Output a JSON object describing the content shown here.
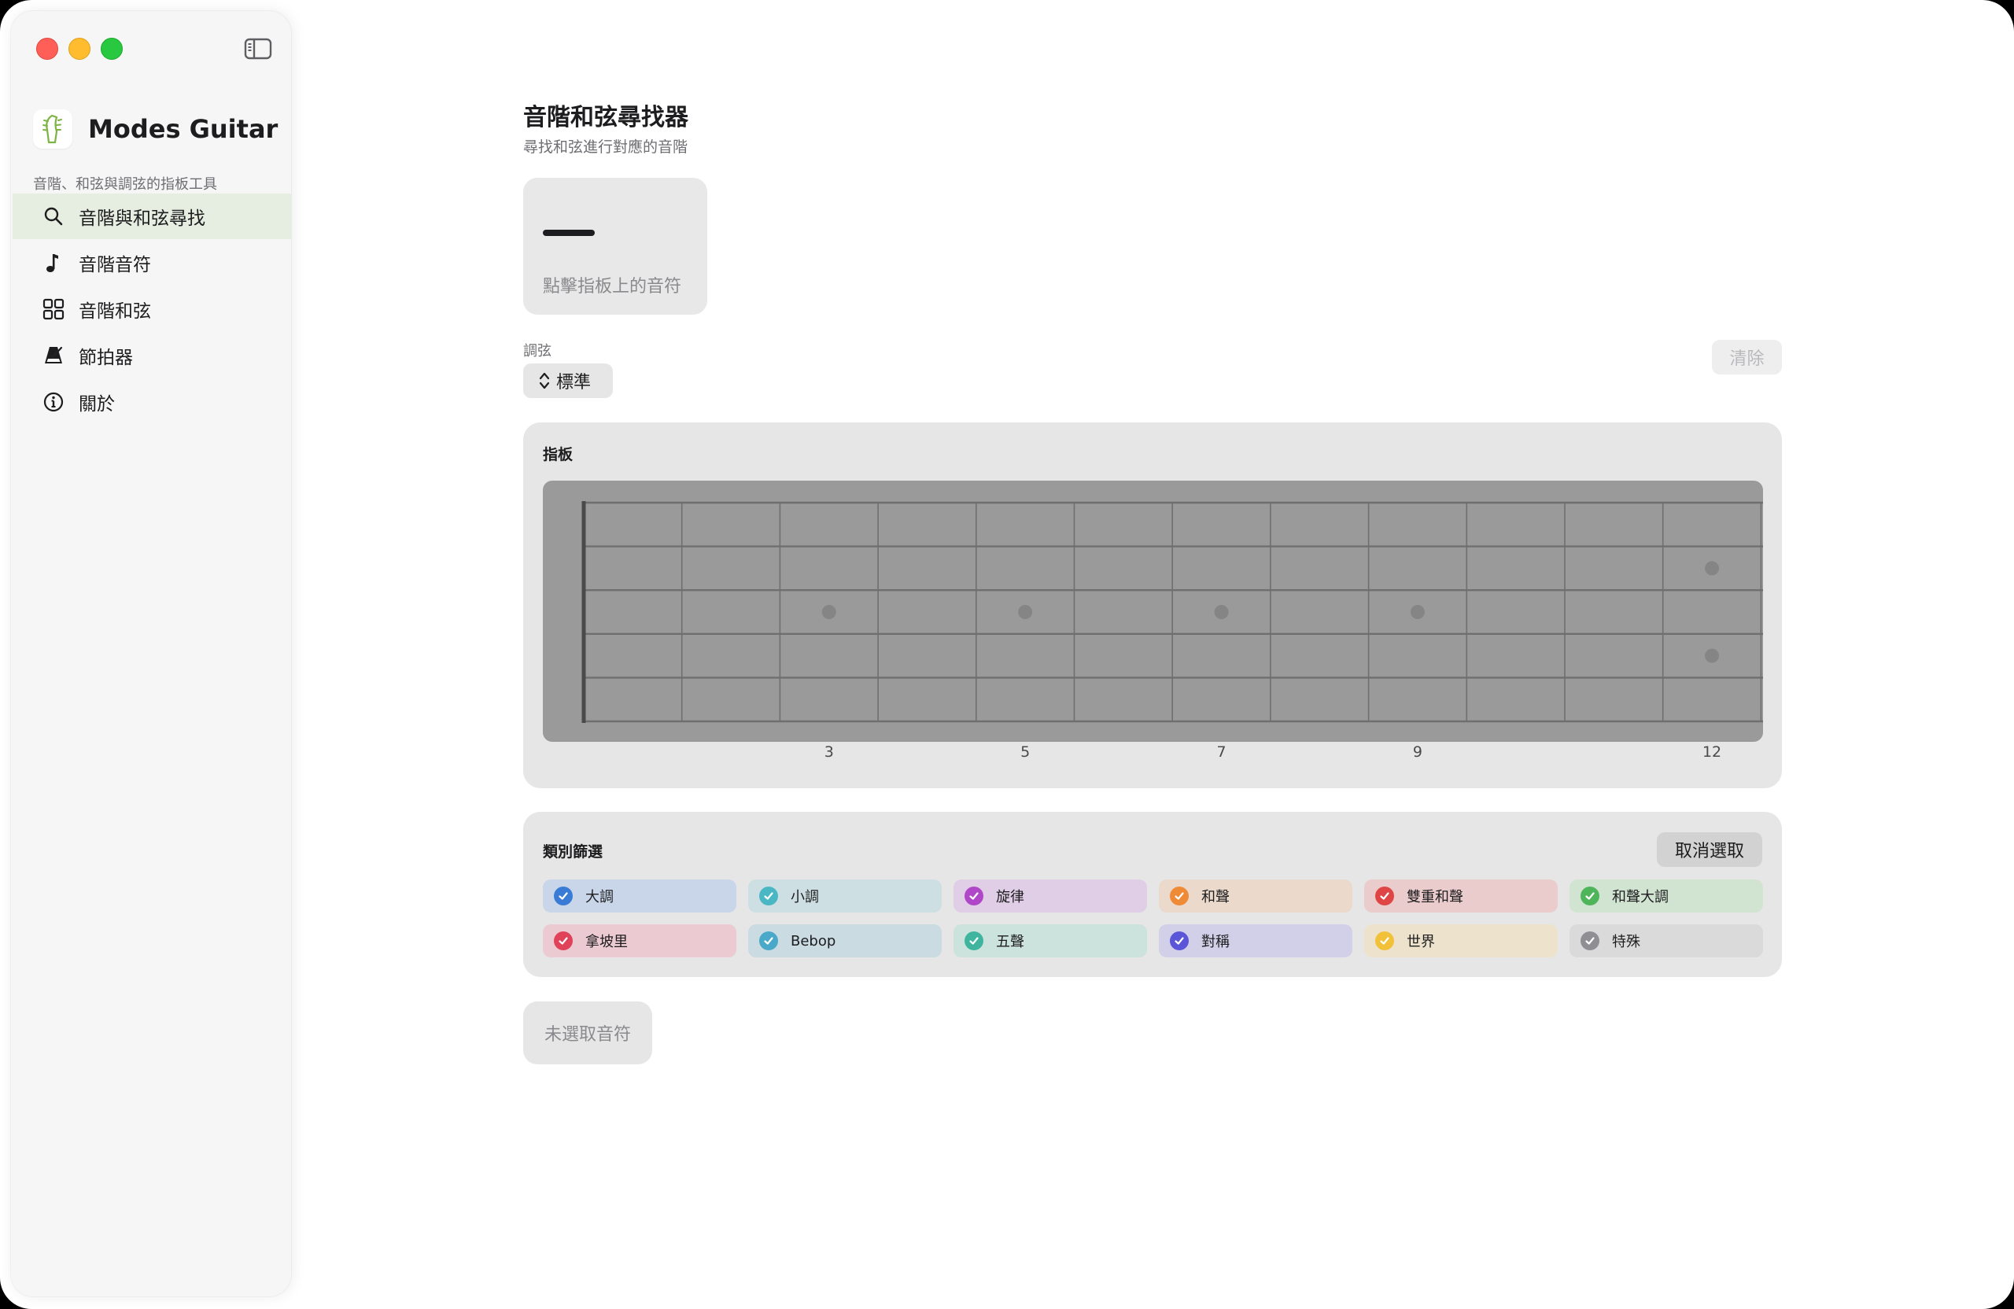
{
  "window": {
    "controls": [
      "close",
      "minimize",
      "maximize"
    ],
    "sidebar_toggle_icon": "sidebar-icon"
  },
  "sidebar": {
    "app_name": "Modes Guitar",
    "app_subtitle": "音階、和弦與調弦的指板工具",
    "logo_icon": "guitar-headstock-icon",
    "items": [
      {
        "label": "音階與和弦尋找",
        "icon": "search-icon",
        "active": true
      },
      {
        "label": "音階音符",
        "icon": "music-note-icon",
        "active": false
      },
      {
        "label": "音階和弦",
        "icon": "grid-icon",
        "active": false
      },
      {
        "label": "節拍器",
        "icon": "metronome-icon",
        "active": false
      },
      {
        "label": "關於",
        "icon": "info-icon",
        "active": false
      }
    ]
  },
  "main": {
    "title": "音階和弦尋找器",
    "subtitle": "尋找和弦進行對應的音階",
    "selection": {
      "placeholder": "—",
      "hint": "點擊指板上的音符"
    },
    "tuning": {
      "label": "調弦",
      "value": "標準"
    },
    "clear_label": "清除",
    "fretboard": {
      "title": "指板",
      "frets": 12,
      "strings": 6,
      "fret_markers": [
        "3",
        "5",
        "7",
        "9",
        "12"
      ],
      "colors": {
        "board": "#9a9a9a",
        "line": "#6f6f6f",
        "dot": "#858585"
      }
    },
    "filter": {
      "title": "類別篩選",
      "deselect_label": "取消選取",
      "categories": [
        {
          "label": "大調",
          "color": "#3a7bd5",
          "bg": "#c9d6ea"
        },
        {
          "label": "小調",
          "color": "#4ab8c4",
          "bg": "#cddfe3"
        },
        {
          "label": "旋律",
          "color": "#b046c8",
          "bg": "#e0cde6"
        },
        {
          "label": "和聲",
          "color": "#ef8a37",
          "bg": "#ebdacb"
        },
        {
          "label": "雙重和聲",
          "color": "#e04545",
          "bg": "#ebcccd"
        },
        {
          "label": "和聲大調",
          "color": "#4fb55a",
          "bg": "#d1e3d1"
        },
        {
          "label": "拿坡里",
          "color": "#e0425a",
          "bg": "#ebcbd1"
        },
        {
          "label": "Bebop",
          "color": "#4aa8c8",
          "bg": "#cadbe2"
        },
        {
          "label": "五聲",
          "color": "#3fb5a0",
          "bg": "#cce2dd"
        },
        {
          "label": "對稱",
          "color": "#5b55d8",
          "bg": "#d1d0e8"
        },
        {
          "label": "世界",
          "color": "#f2c13a",
          "bg": "#ede3cd"
        },
        {
          "label": "特殊",
          "color": "#8e8e93",
          "bg": "#dadada"
        }
      ]
    },
    "selected_notes_empty": "未選取音符"
  }
}
